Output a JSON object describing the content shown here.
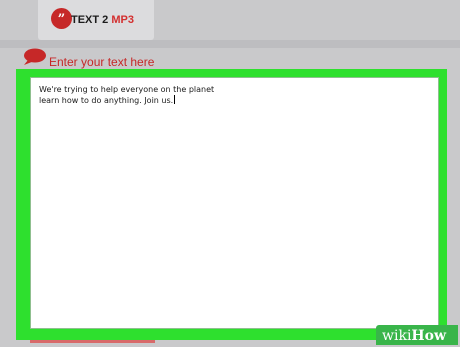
{
  "header": {
    "logo_badge": "”",
    "logo_text_main": "TEXT 2 ",
    "logo_text_accent": "MP3"
  },
  "input": {
    "label": "Enter your text here",
    "value": "We're trying to help everyone on the planet\nlearn how to do anything. Join us."
  },
  "watermark": {
    "part1": "wiki",
    "part2": "How"
  },
  "colors": {
    "accent_red": "#c62828",
    "frame_green": "#2ee02e"
  },
  "icons": {
    "label_icon": "speech-bubble-icon",
    "logo_icon": "quote-badge-icon"
  }
}
